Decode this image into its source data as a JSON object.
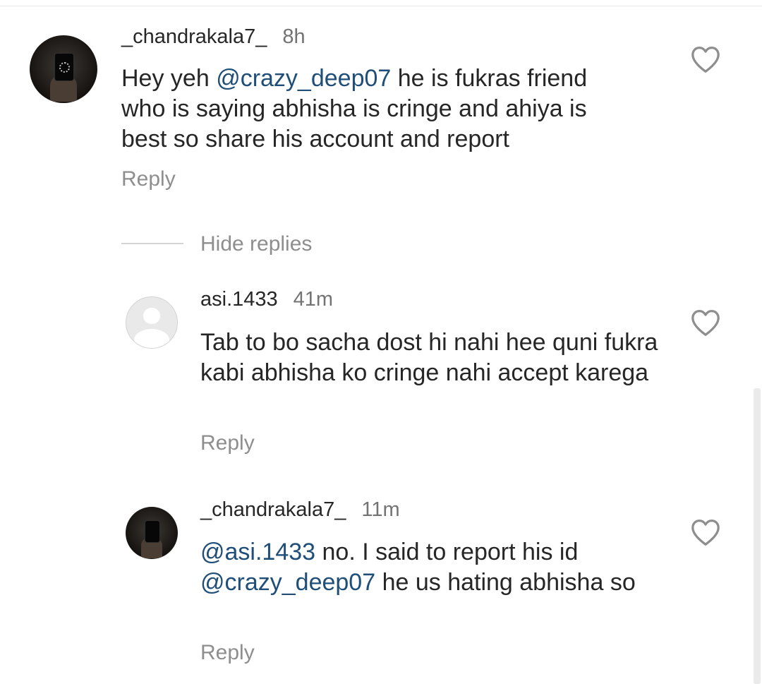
{
  "comments": [
    {
      "username": "_chandrakala7_",
      "time": "8h",
      "text_parts": [
        "Hey yeh ",
        "@crazy_deep07",
        "  he is fukras friend who is saying abhisha is cringe and ahiya is best so share his account and report"
      ],
      "reply_label": "Reply",
      "avatar": "profile-photo"
    }
  ],
  "thread": {
    "hide_replies_label": "Hide replies"
  },
  "replies": [
    {
      "username": "asi.1433",
      "time": "41m",
      "text": "Tab to bo sacha dost hi nahi hee quni fukra kabi abhisha ko cringe nahi accept karega",
      "reply_label": "Reply",
      "avatar": "default-avatar"
    },
    {
      "username": "_chandrakala7_",
      "time": "11m",
      "text_parts": [
        "@asi.1433",
        " no. I said to report his id ",
        "@crazy_deep07",
        "  he us hating abhisha so"
      ],
      "reply_label": "Reply",
      "avatar": "profile-photo"
    }
  ],
  "icons": {
    "like": "heart-outline-icon"
  },
  "colors": {
    "mention": "#1f4e79",
    "text": "#262626",
    "secondary": "#8e8e8e"
  }
}
